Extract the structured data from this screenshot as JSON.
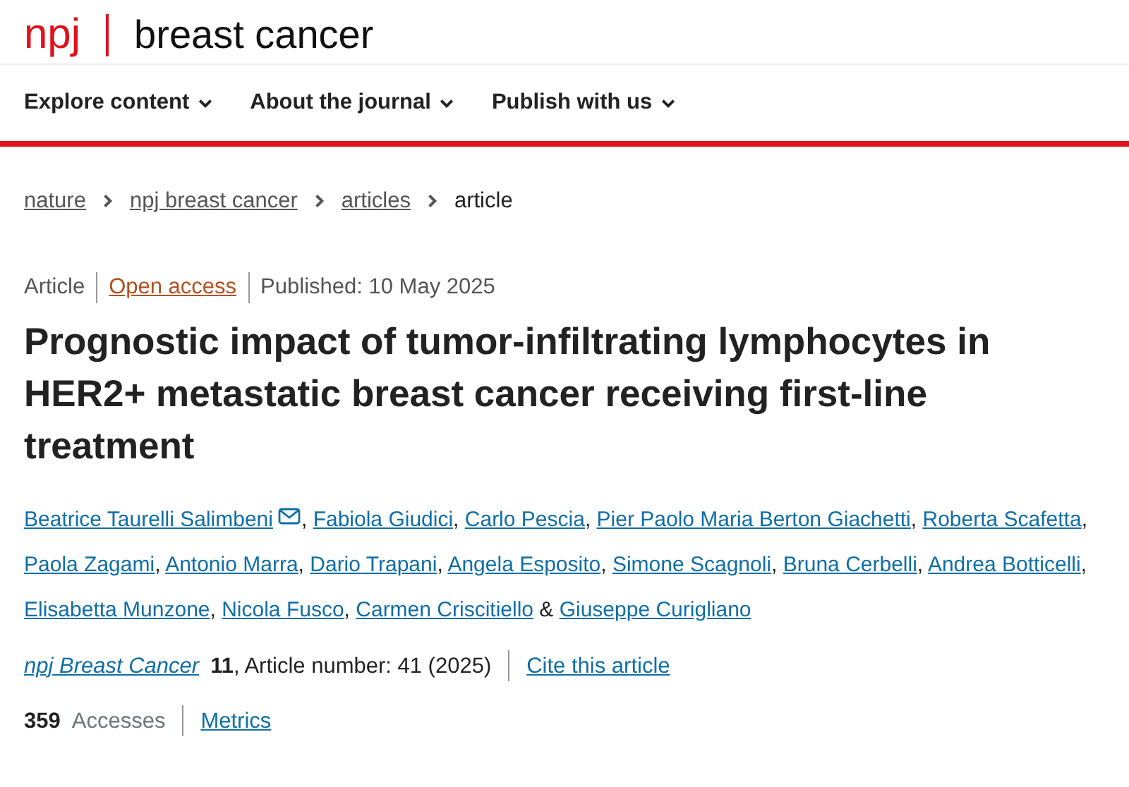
{
  "header": {
    "logo": "npj",
    "journal_title": "breast cancer"
  },
  "nav": [
    {
      "label": "Explore content"
    },
    {
      "label": "About the journal"
    },
    {
      "label": "Publish with us"
    }
  ],
  "breadcrumbs": [
    {
      "label": "nature",
      "current": false
    },
    {
      "label": "npj breast cancer",
      "current": false
    },
    {
      "label": "articles",
      "current": false
    },
    {
      "label": "article",
      "current": true
    }
  ],
  "meta": {
    "type": "Article",
    "access": "Open access",
    "published": "Published: 10 May 2025"
  },
  "title": "Prognostic impact of tumor-infiltrating lymphocytes in HER2+ metastatic breast cancer receiving first-line treatment",
  "authors": [
    {
      "name": "Beatrice Taurelli Salimbeni",
      "corresponding": true
    },
    {
      "name": "Fabiola Giudici",
      "corresponding": false
    },
    {
      "name": "Carlo Pescia",
      "corresponding": false
    },
    {
      "name": "Pier Paolo Maria Berton Giachetti",
      "corresponding": false
    },
    {
      "name": "Roberta Scafetta",
      "corresponding": false
    },
    {
      "name": "Paola Zagami",
      "corresponding": false
    },
    {
      "name": "Antonio Marra",
      "corresponding": false
    },
    {
      "name": "Dario Trapani",
      "corresponding": false
    },
    {
      "name": "Angela Esposito",
      "corresponding": false
    },
    {
      "name": "Simone Scagnoli",
      "corresponding": false
    },
    {
      "name": "Bruna Cerbelli",
      "corresponding": false
    },
    {
      "name": "Andrea Botticelli",
      "corresponding": false
    },
    {
      "name": "Elisabetta Munzone",
      "corresponding": false
    },
    {
      "name": "Nicola Fusco",
      "corresponding": false
    },
    {
      "name": "Carmen Criscitiello",
      "corresponding": false
    },
    {
      "name": "Giuseppe Curigliano",
      "corresponding": false
    }
  ],
  "author_separator": ",",
  "author_last_separator": "&",
  "citation": {
    "journal": "npj Breast Cancer",
    "details": "**11**, Article number: 41 (2025)",
    "cite_link": "Cite this article"
  },
  "metrics": {
    "count": "359",
    "label": "Accesses",
    "link": "Metrics"
  }
}
